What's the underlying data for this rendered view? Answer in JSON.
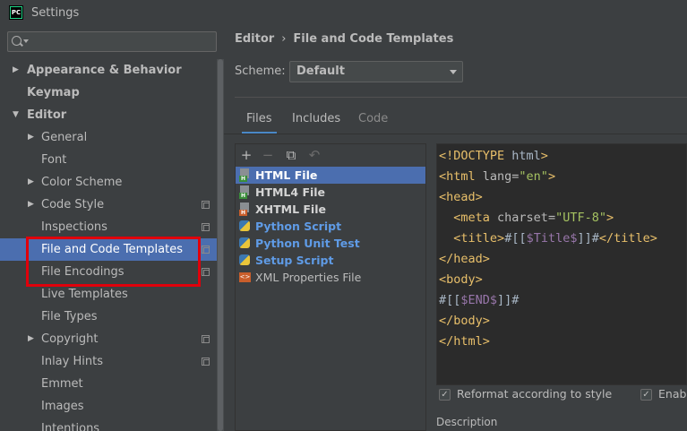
{
  "window": {
    "title": "Settings",
    "app_icon": "PC"
  },
  "search": {
    "placeholder": ""
  },
  "tree": [
    {
      "label": "Appearance & Behavior",
      "level": 0,
      "arrow": "▶",
      "bold": true
    },
    {
      "label": "Keymap",
      "level": 0,
      "arrow": "",
      "bold": true
    },
    {
      "label": "Editor",
      "level": 0,
      "arrow": "▼",
      "bold": true
    },
    {
      "label": "General",
      "level": 1,
      "arrow": "▶"
    },
    {
      "label": "Font",
      "level": 1,
      "arrow": ""
    },
    {
      "label": "Color Scheme",
      "level": 1,
      "arrow": "▶"
    },
    {
      "label": "Code Style",
      "level": 1,
      "arrow": "▶",
      "copy": true
    },
    {
      "label": "Inspections",
      "level": 1,
      "arrow": "",
      "copy": true
    },
    {
      "label": "File and Code Templates",
      "level": 1,
      "arrow": "",
      "copy": true,
      "selected": true
    },
    {
      "label": "File Encodings",
      "level": 1,
      "arrow": "",
      "copy": true
    },
    {
      "label": "Live Templates",
      "level": 1,
      "arrow": ""
    },
    {
      "label": "File Types",
      "level": 1,
      "arrow": ""
    },
    {
      "label": "Copyright",
      "level": 1,
      "arrow": "▶",
      "copy": true
    },
    {
      "label": "Inlay Hints",
      "level": 1,
      "arrow": "",
      "copy": true
    },
    {
      "label": "Emmet",
      "level": 1,
      "arrow": ""
    },
    {
      "label": "Images",
      "level": 1,
      "arrow": ""
    },
    {
      "label": "Intentions",
      "level": 1,
      "arrow": ""
    }
  ],
  "breadcrumb": {
    "parent": "Editor",
    "separator": "›",
    "current": "File and Code Templates"
  },
  "scheme": {
    "label": "Scheme:",
    "value": "Default"
  },
  "tabs": [
    {
      "label": "Files",
      "state": "active"
    },
    {
      "label": "Includes",
      "state": "normal"
    },
    {
      "label": "Code",
      "state": "disabled"
    }
  ],
  "toolbar": {
    "add": "+",
    "remove": "−",
    "copy": "⧉",
    "reset": "↶"
  },
  "templates": [
    {
      "label": "HTML File",
      "icon": "html",
      "tag": "H",
      "tag_color": "#3a8d3a",
      "style": "white",
      "selected": true
    },
    {
      "label": "HTML4 File",
      "icon": "html",
      "tag": "H",
      "tag_color": "#3a8d3a",
      "style": "white"
    },
    {
      "label": "XHTML File",
      "icon": "html",
      "tag": "H",
      "tag_color": "#c95e2b",
      "style": "white"
    },
    {
      "label": "Python Script",
      "icon": "python",
      "style": "blue"
    },
    {
      "label": "Python Unit Test",
      "icon": "python",
      "style": "blue"
    },
    {
      "label": "Setup Script",
      "icon": "python",
      "style": "blue"
    },
    {
      "label": "XML Properties File",
      "icon": "xml",
      "style": "plain"
    }
  ],
  "code_lines": [
    "<!DOCTYPE html>",
    "<html lang=\"en\">",
    "<head>",
    "  <meta charset=\"UTF-8\">",
    "  <title>#[[$Title$]]#</title>",
    "</head>",
    "<body>",
    "#[[$END$]]#",
    "</body>",
    "</html>"
  ],
  "options": {
    "reformat_label": "Reformat according to style",
    "reformat_checked": true,
    "enable_label": "Enabl",
    "enable_checked": true
  },
  "description_label": "Description",
  "colors": {
    "selection": "#4b6eaf",
    "highlight_box": "#e0000b",
    "tab_underline": "#4a88c7"
  }
}
